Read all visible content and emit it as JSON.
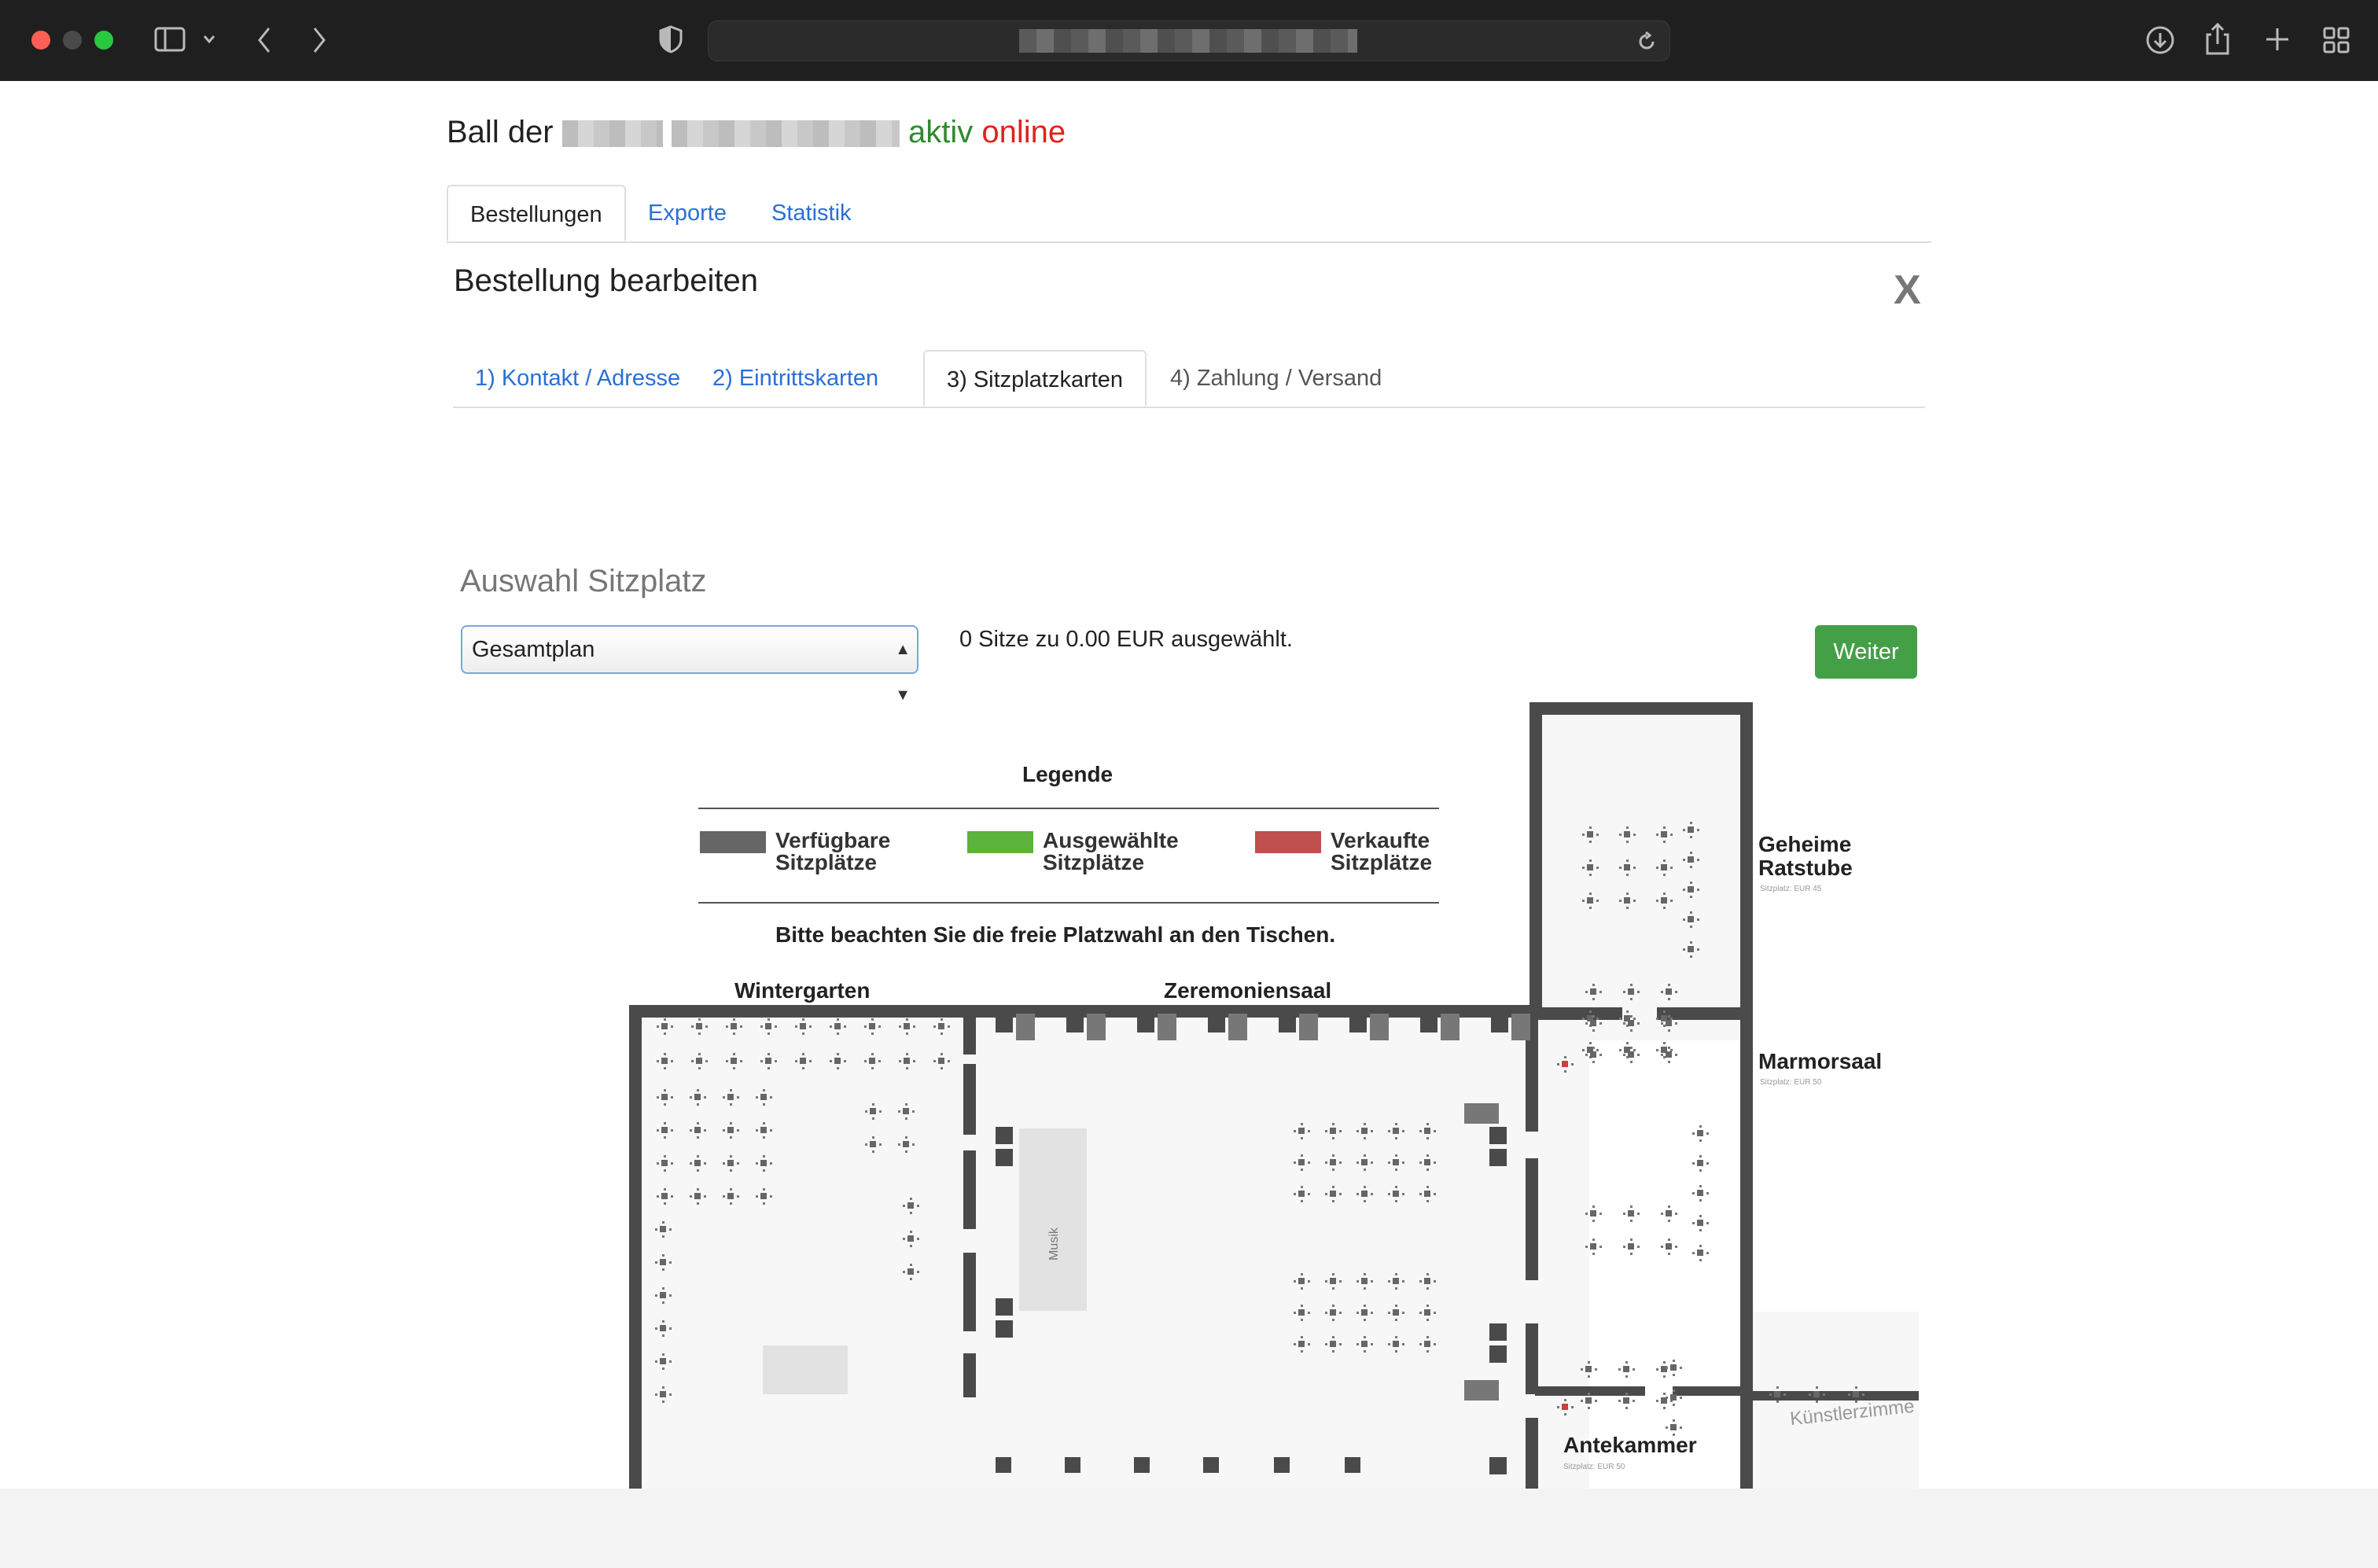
{
  "browser": {
    "address_text": "",
    "icons": [
      "sidebar-icon",
      "chevron-down-icon",
      "back-icon",
      "forward-icon",
      "shield-icon",
      "reload-icon",
      "download-icon",
      "share-icon",
      "new-tab-icon",
      "tab-overview-icon"
    ]
  },
  "header": {
    "title_prefix": "Ball der",
    "status_active": "aktiv",
    "status_online": "online"
  },
  "main_tabs": [
    {
      "label": "Bestellungen",
      "active": true
    },
    {
      "label": "Exporte",
      "active": false
    },
    {
      "label": "Statistik",
      "active": false
    }
  ],
  "panel": {
    "title": "Bestellung bearbeiten",
    "close_label": "X"
  },
  "step_tabs": [
    {
      "label": "1) Kontakt / Adresse",
      "state": "link"
    },
    {
      "label": "2) Eintrittskarten",
      "state": "link"
    },
    {
      "label": "3) Sitzplatzkarten",
      "state": "active"
    },
    {
      "label": "4) Zahlung / Versand",
      "state": "disabled"
    }
  ],
  "seat_selection": {
    "heading": "Auswahl Sitzplatz",
    "plan_select_value": "Gesamtplan",
    "summary": "0 Sitze zu 0.00 EUR ausgewählt.",
    "next_button": "Weiter"
  },
  "legend": {
    "title": "Legende",
    "items": [
      {
        "line1": "Verfügbare",
        "line2": "Sitzplätze",
        "color": "#666666"
      },
      {
        "line1": "Ausgewählte",
        "line2": "Sitzplätze",
        "color": "#5cb43c"
      },
      {
        "line1": "Verkaufte",
        "line2": "Sitzplätze",
        "color": "#c0504d"
      }
    ],
    "note": "Bitte beachten Sie die freie Platzwahl an den Tischen."
  },
  "rooms": {
    "wintergarten": "Wintergarten",
    "zeremoniensaal": "Zeremoniensaal",
    "geheime_line1": "Geheime",
    "geheime_line2": "Ratstube",
    "geheime_price": "Sitzplatz: EUR 45",
    "marmorsaal": "Marmorsaal",
    "marmorsaal_price": "Sitzplatz: EUR 50",
    "antekammer": "Antekammer",
    "antekammer_price": "Sitzplatz: EUR 50",
    "kuenstlerzimmer": "Künstlerzimme",
    "musik": "Musik"
  }
}
